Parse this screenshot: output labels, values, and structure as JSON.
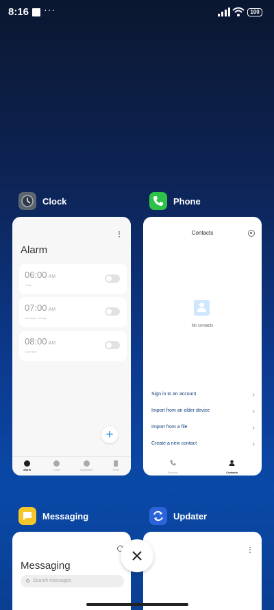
{
  "status_bar": {
    "time": "8:16",
    "dots": "···",
    "battery": "100"
  },
  "clock_app": {
    "name": "Clock",
    "title": "Alarm",
    "alarms": [
      {
        "time": "06:00",
        "ampm": "AM",
        "sub": "Daily",
        "enabled": false
      },
      {
        "time": "07:00",
        "ampm": "AM",
        "sub": "Monday to Friday",
        "enabled": false
      },
      {
        "time": "08:00",
        "ampm": "AM",
        "sub": "One time",
        "enabled": false
      }
    ],
    "fab_label": "+",
    "nav": [
      {
        "label": "Alarm",
        "active": true
      },
      {
        "label": "Clock",
        "active": false
      },
      {
        "label": "Stopwatch",
        "active": false
      },
      {
        "label": "Timer",
        "active": false
      }
    ]
  },
  "phone_app": {
    "name": "Phone",
    "title": "Contacts",
    "empty_text": "No contacts",
    "actions": [
      "Sign in to an account",
      "Import from an older device",
      "Import from a file",
      "Create a new contact"
    ],
    "nav": [
      {
        "label": "Recents",
        "active": false
      },
      {
        "label": "Contacts",
        "active": true
      }
    ]
  },
  "messaging_app": {
    "name": "Messaging",
    "title": "Messaging",
    "search_placeholder": "Search messages"
  },
  "updater_app": {
    "name": "Updater"
  },
  "colors": {
    "accent_blue": "#1a88e8",
    "phone_green": "#2ec24b",
    "messaging_yellow": "#f7c62a",
    "updater_blue": "#2d63d8"
  }
}
